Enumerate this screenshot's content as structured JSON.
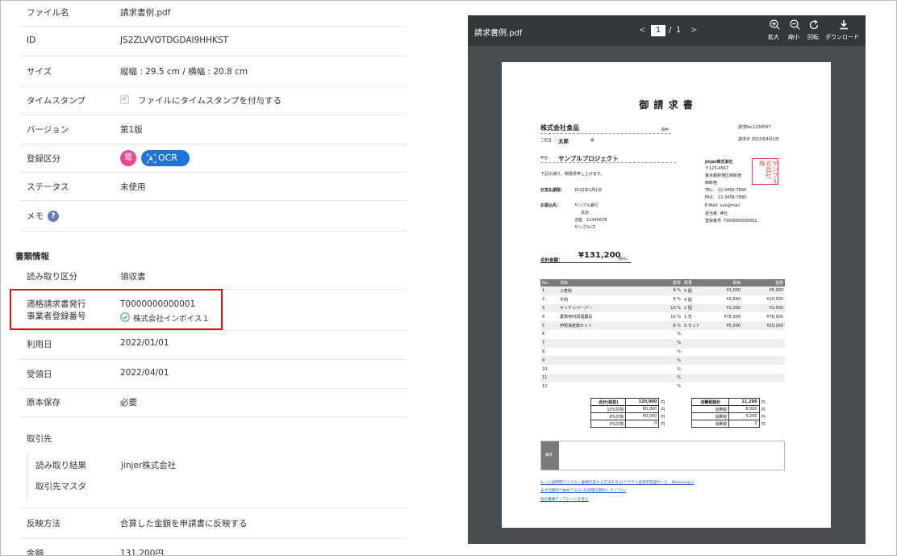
{
  "details": {
    "rows": [
      {
        "label": "ファイル名",
        "value": "請求書例.pdf"
      },
      {
        "label": "ID",
        "value": "JS2ZLVVOTDGDAI9HHKST"
      },
      {
        "label": "サイズ",
        "value": "縦幅 : 29.5 cm / 横幅 : 20.8 cm"
      },
      {
        "label": "タイムスタンプ",
        "value": "ファイルにタイムスタンプを付与する"
      },
      {
        "label": "バージョン",
        "value": "第1版"
      },
      {
        "label": "登録区分",
        "value": ""
      },
      {
        "label": "ステータス",
        "value": "未使用"
      },
      {
        "label": "メモ",
        "value": ""
      }
    ],
    "register_badges": {
      "den": "電",
      "ocr": "OCR"
    },
    "memo_help": "?",
    "timestamp_check": "✓"
  },
  "doc_info": {
    "title": "書類情報",
    "reading_label": "読み取り区分",
    "reading_value": "領収書",
    "invoice_label_1": "適格請求書発行",
    "invoice_label_2": "事業者登録番号",
    "invoice_number": "T0000000000001",
    "invoice_company": "株式会社インボイス１",
    "use_date_label": "利用日",
    "use_date_value": "2022/01/01",
    "receive_date_label": "受領日",
    "receive_date_value": "2022/04/01",
    "original_label": "原本保存",
    "original_value": "必要",
    "partner_label": "取引先",
    "partner_result_label": "読み取り結果",
    "partner_result_value": "jinjer株式会社",
    "partner_master_label": "取引先マスタ",
    "reflect_label": "反映方法",
    "reflect_value": "合算した金額を申請書に反映する",
    "amount_label": "金額",
    "amount_value": "131,200円"
  },
  "viewer": {
    "filename": "請求書例.pdf",
    "page_prev": "<",
    "page_current": "1",
    "page_sep": "/",
    "page_total": "1",
    "page_next": ">",
    "tools": {
      "zoom_in": "拡大",
      "zoom_out": "縮小",
      "rotate": "回転",
      "download": "ダウンロード"
    }
  },
  "invoice_doc": {
    "title": "御 請 求 書",
    "client": "株式会社食品",
    "client_honorific": "御中",
    "person_prefix": "ご担当",
    "person": "太郎",
    "person_honorific": "様",
    "invoice_no": "請求No.1234567",
    "invoice_date": "請求日 2022年4月1日",
    "subject_label": "件名：",
    "subject": "サンプルプロジェクト",
    "intro": "下記の通り、御請求申し上げます。",
    "due_label": "お支払期限：",
    "due_value": "2022年1月1日",
    "bank_label": "お振込先：",
    "bank_lines": [
      "サンプル銀行",
      "本店",
      "当座　12345678",
      "サンプル(カ"
    ],
    "issuer_lines": [
      "jinjer株式会社",
      "〒123-4567",
      "東京都新宿区西新宿",
      "西新宿",
      "TEL:　12-3456-7890",
      "FAX:　12-3456-7890",
      "E-Mail: xxx@mail",
      "担当者: 神社",
      "登録番号: T000000000001"
    ],
    "seal_text": "株サ式ン会プ社ル",
    "total_label": "合計金額：",
    "total_value": "¥131,200",
    "total_tax": "(税込)",
    "table_headers": [
      "No.",
      "項目",
      "税率",
      "数量",
      "単価",
      "金額"
    ],
    "items": [
      [
        "1",
        "小麦粉",
        "8 %",
        "5 個",
        "¥1,000",
        "¥5,000"
      ],
      [
        "2",
        "牛肉",
        "8 %",
        "4 個",
        "¥2,500",
        "¥10,000"
      ],
      [
        "3",
        "キッチンペーパー",
        "10 %",
        "2 個",
        "¥1,000",
        "¥2,000"
      ],
      [
        "4",
        "業務用IH調理器具",
        "10 %",
        "1 式",
        "¥78,000",
        "¥78,000"
      ],
      [
        "5",
        "伊勢海老鍋セット",
        "8 %",
        "5 セット",
        "¥5,000",
        "¥25,000"
      ],
      [
        "6",
        "",
        "%",
        "",
        "",
        ""
      ],
      [
        "7",
        "",
        "%",
        "",
        "",
        ""
      ],
      [
        "8",
        "",
        "%",
        "",
        "",
        ""
      ],
      [
        "9",
        "",
        "%",
        "",
        "",
        ""
      ],
      [
        "10",
        "",
        "%",
        "",
        "",
        ""
      ],
      [
        "11",
        "",
        "%",
        "",
        "",
        ""
      ],
      [
        "12",
        "",
        "%",
        "",
        "",
        ""
      ]
    ],
    "summary_left": [
      [
        "合計(税抜)",
        "120,000",
        "円"
      ],
      [
        "10%対象",
        "80,000",
        "円"
      ],
      [
        "8%対象",
        "40,000",
        "円"
      ],
      [
        "0%対象",
        "0",
        "円"
      ]
    ],
    "summary_right": [
      [
        "消費税額計",
        "11,200",
        "円"
      ],
      [
        "消費税",
        "8,000",
        "円"
      ],
      [
        "消費税",
        "3,200",
        "円"
      ],
      [
        "消費税",
        "0",
        "円"
      ]
    ],
    "remarks_label": "備考",
    "links": [
      "もっと短時間でミスなく書類作成する方法を見る[クラウド型請求管理サービ＿MakeLeaps]",
      "まずは無料で始めてみる(30日間の無料トライアル)",
      "他の書類テンプレートを見る"
    ]
  },
  "colors": {
    "accent_blue": "#1f74d9",
    "den_pink": "#e8478b",
    "highlight_red": "#d9141a",
    "viewer_bg": "#4a4d4f",
    "toolbar_bg": "#34373a",
    "check_green": "#3aa655"
  }
}
